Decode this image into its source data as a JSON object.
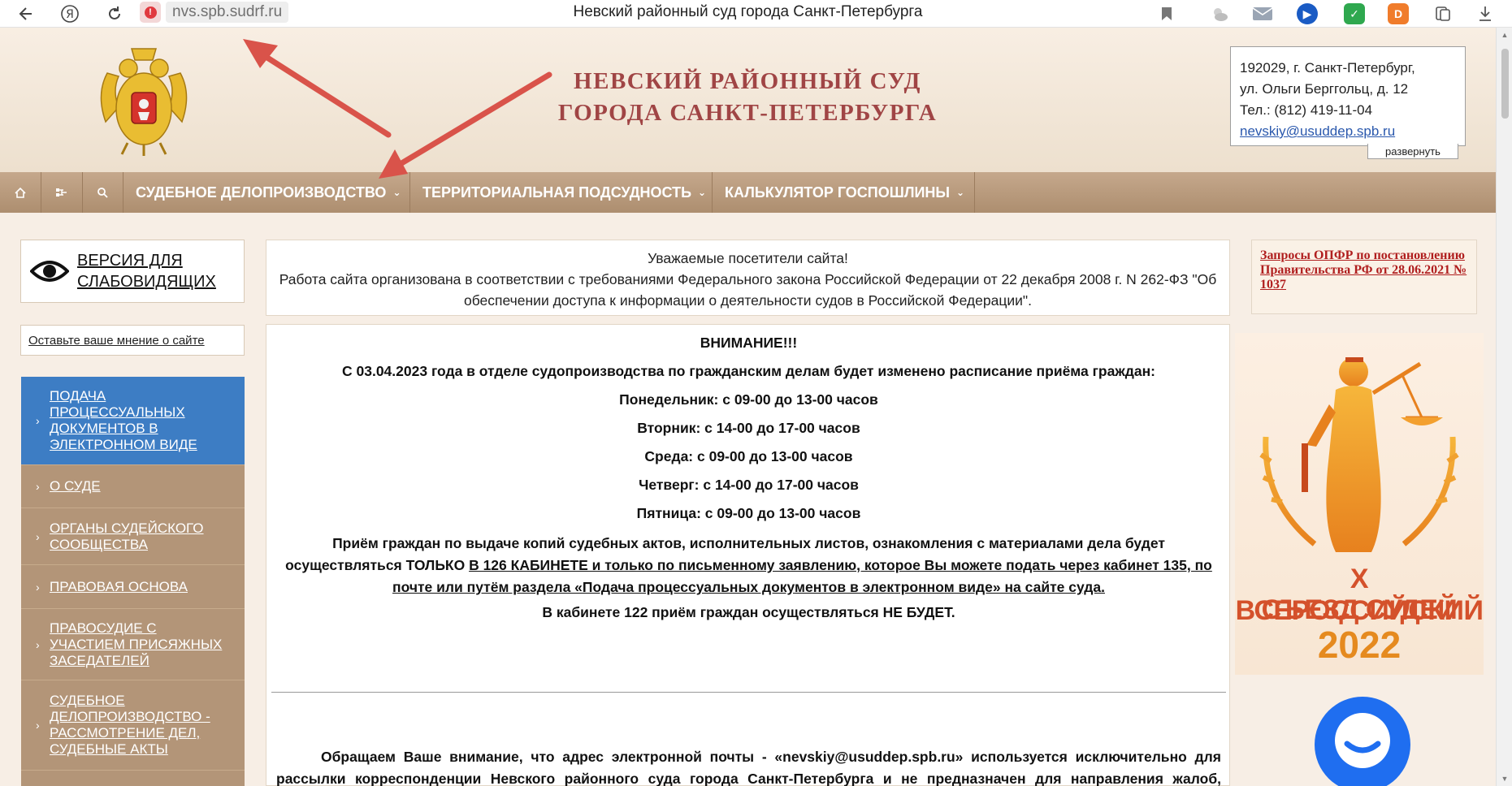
{
  "browser": {
    "url": "nvs.spb.sudrf.ru",
    "tab_title": "Невский районный суд города Санкт-Петербурга",
    "back_icon": "arrow-left-icon",
    "reload_icon": "reload-icon",
    "warning_icon": "security-warning-icon",
    "bookmark_icon": "bookmark-icon",
    "download_icon": "download-icon"
  },
  "header": {
    "title_line1": "НЕВСКИЙ РАЙОННЫЙ СУД",
    "title_line2": "ГОРОДА САНКТ-ПЕТЕРБУРГА",
    "contact": {
      "line1": "192029, г. Санкт-Петербург,",
      "line2": "ул. Ольги Берггольц, д. 12",
      "phone": "Тел.: (812) 419-11-04",
      "email": "nevskiy@usuddep.spb.ru"
    },
    "expand_label": "развернуть"
  },
  "topnav": {
    "icons": [
      "home-icon",
      "sitemap-icon",
      "search-icon"
    ],
    "menus": [
      {
        "label": "СУДЕБНОЕ ДЕЛОПРОИЗВОДСТВО"
      },
      {
        "label": "ТЕРРИТОРИАЛЬНАЯ ПОДСУДНОСТЬ"
      },
      {
        "label": "КАЛЬКУЛЯТОР ГОСПОШЛИНЫ"
      }
    ],
    "caret": "⌄"
  },
  "sidebar": {
    "low_vision": "ВЕРСИЯ ДЛЯ СЛАБОВИДЯЩИХ",
    "feedback": "Оставьте ваше мнение о сайте",
    "chevron": "›",
    "items": [
      {
        "label": "ПОДАЧА ПРОЦЕССУАЛЬНЫХ ДОКУМЕНТОВ В ЭЛЕКТРОННОМ ВИДЕ"
      },
      {
        "label": "О СУДЕ"
      },
      {
        "label": "ОРГАНЫ СУДЕЙСКОГО СООБЩЕСТВА"
      },
      {
        "label": "ПРАВОВАЯ ОСНОВА"
      },
      {
        "label": "ПРАВОСУДИЕ С УЧАСТИЕМ ПРИСЯЖНЫХ ЗАСЕДАТЕЛЕЙ"
      },
      {
        "label": "СУДЕБНОЕ ДЕЛОПРОИЗВОДСТВО - РАССМОТРЕНИЕ ДЕЛ, СУДЕБНЫЕ АКТЫ"
      }
    ]
  },
  "notice": {
    "line1": "Уважаемые посетители сайта!",
    "text": "Работа сайта организована в соответствии с требованиями Федерального закона Российской Федерации от 22 декабря 2008 г. N 262-ФЗ \"Об обеспечении доступа к информации о деятельности судов в Российской Федерации\"."
  },
  "content": {
    "attention": "ВНИМАНИЕ!!!",
    "schedule_intro": "С 03.04.2023 года в отделе судопроизводства по гражданским делам будет изменено расписание приёма граждан:",
    "schedule": [
      "Понедельник: с 09-00 до 13-00 часов",
      "Вторник: с 14-00 до 17-00 часов",
      "Среда: с 09-00 до 13-00 часов",
      "Четверг: с 14-00 до 17-00 часов",
      "Пятница: с 09-00 до 13-00 часов"
    ],
    "reception_part1": "Приём граждан по выдаче копий судебных актов, исполнительных листов, ознакомления с материалами дела будет осуществляться ТОЛЬКО ",
    "reception_part2": "В 126 КАБИНЕТЕ и только по письменному заявлению, которое Вы можете подать через кабинет 135, по почте или путём раздела «Подача процессуальных документов в электронном виде» на сайте суда.",
    "cabinet_122": "В кабинете 122 приём граждан осуществляться НЕ БУДЕТ.",
    "email_notice": "Обращаем Ваше внимание, что адрес электронной почты - «nevskiy@usuddep.spb.ru» используется исключительно для рассылки корреспонденции Невского районного суда города Санкт-Петербурга и не предназначен для направления жалоб, исковых"
  },
  "right": {
    "pension_link": "Запросы ОПФР по постановлению Правительства РФ от 28.06.2021 № 1037",
    "banner": {
      "line1": "X ВСЕРОССИЙСКИЙ",
      "line2": "СЪЕЗД СУДЕЙ",
      "year": "2022",
      "image_icon": "themis-statue-icon"
    },
    "chat_icon": "chat-bubble-icon"
  },
  "colors": {
    "nav_bg": "#b99a7b",
    "active_side": "#3d7dc4",
    "title_red": "#a04545",
    "link_red": "#b01e1e",
    "arrow_red": "#d9534a"
  }
}
